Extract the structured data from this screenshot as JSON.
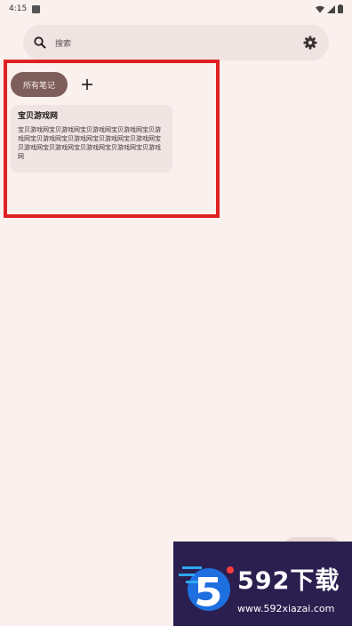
{
  "status_bar": {
    "time": "4:15"
  },
  "search": {
    "placeholder": "搜索"
  },
  "filters": {
    "all_notes_label": "所有笔记"
  },
  "notes": [
    {
      "title": "宝贝游戏网",
      "body": "宝贝游戏网宝贝游戏网宝贝游戏网宝贝游戏网宝贝游戏网宝贝游戏网宝贝游戏网宝贝游戏网宝贝游戏网宝贝游戏网宝贝游戏网宝贝游戏网宝贝游戏网宝贝游戏网"
    }
  ],
  "watermark": {
    "brand": "592下载",
    "url": "www.592xiazai.com"
  },
  "colors": {
    "background": "#FAF0EE",
    "chip": "#7E5E5B",
    "highlight": "#E02020"
  }
}
